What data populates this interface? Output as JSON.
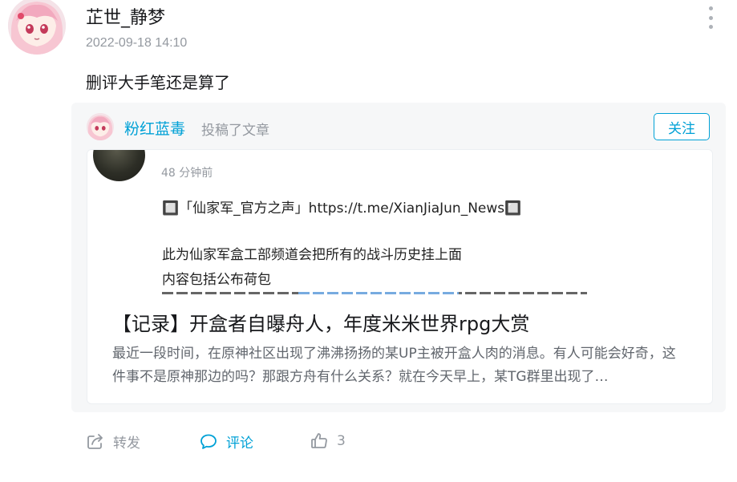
{
  "post": {
    "username": "芷世_静梦",
    "timestamp": "2022-09-18 14:10",
    "text": "删评大手笔还是算了"
  },
  "shared": {
    "author": "粉红蓝毒",
    "action": "投稿了文章",
    "follow_label": "关注",
    "preview": {
      "time": "48 分钟前",
      "line1": "🔲「仙家军_官方之声」https://t.me/XianJiaJun_News🔲",
      "line2": "此为仙家军盒工部频道会把所有的战斗历史挂上面",
      "line3": "内容包括公布荷包"
    },
    "article_title": "【记录】开盒者自曝舟人，年度米米世界rpg大赏",
    "article_desc": "最近一段时间，在原神社区出现了沸沸扬扬的某UP主被开盒人肉的消息。有人可能会好奇，这件事不是原神那边的吗？那跟方舟有什么关系？就在今天早上，某TG群里出现了…"
  },
  "actions": {
    "share_label": "转发",
    "comment_label": "评论",
    "like_count": "3"
  },
  "colors": {
    "accent": "#00a1d6",
    "muted": "#9499a0",
    "card_bg": "#f6f7f8"
  },
  "icons": [
    "more-vertical-icon",
    "share-icon",
    "comment-icon",
    "thumbs-up-icon"
  ]
}
